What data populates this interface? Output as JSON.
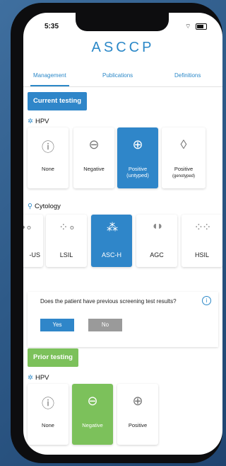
{
  "status": {
    "time": "5:35",
    "signal": "••",
    "wifi": "⌔"
  },
  "app": {
    "logo": "ASCCP"
  },
  "tabs": [
    {
      "label": "Management"
    },
    {
      "label": "Publications"
    },
    {
      "label": "Definitions"
    }
  ],
  "current_testing": {
    "title": "Current testing",
    "hpv_heading": "HPV",
    "hpv_options": [
      {
        "label": "None",
        "sub": "",
        "icon": "question-icon",
        "glyph": "?",
        "selected": false
      },
      {
        "label": "Negative",
        "sub": "",
        "icon": "minus-icon",
        "glyph": "⊖",
        "selected": false
      },
      {
        "label": "Positive",
        "sub": "(untyped)",
        "icon": "plus-icon",
        "glyph": "⊕",
        "selected": true
      },
      {
        "label": "Positive",
        "sub": "(genotyped)",
        "icon": "genotype-icon",
        "glyph": "◊",
        "selected": false
      }
    ],
    "cytology_heading": "Cytology",
    "cytology_options": [
      {
        "label": "-US",
        "cells": "• ∘",
        "selected": false
      },
      {
        "label": "LSIL",
        "cells": "⁘ ∘",
        "selected": false
      },
      {
        "label": "ASC-H",
        "cells": "⁂",
        "selected": true
      },
      {
        "label": "AGC",
        "cells": "◖◗",
        "selected": false
      },
      {
        "label": "HSIL",
        "cells": "⁘⁘",
        "selected": false
      }
    ]
  },
  "question": {
    "text": "Does the patient have previous screening test results?",
    "yes": "Yes",
    "no": "No",
    "info_glyph": "i"
  },
  "prior_testing": {
    "title": "Prior testing",
    "hpv_heading": "HPV",
    "hpv_options": [
      {
        "label": "None",
        "icon": "question-icon",
        "glyph": "?",
        "selected": false
      },
      {
        "label": "Negative",
        "icon": "minus-icon",
        "glyph": "⊖",
        "selected": true
      },
      {
        "label": "Positive",
        "icon": "plus-icon",
        "glyph": "⊕",
        "selected": false
      }
    ]
  }
}
